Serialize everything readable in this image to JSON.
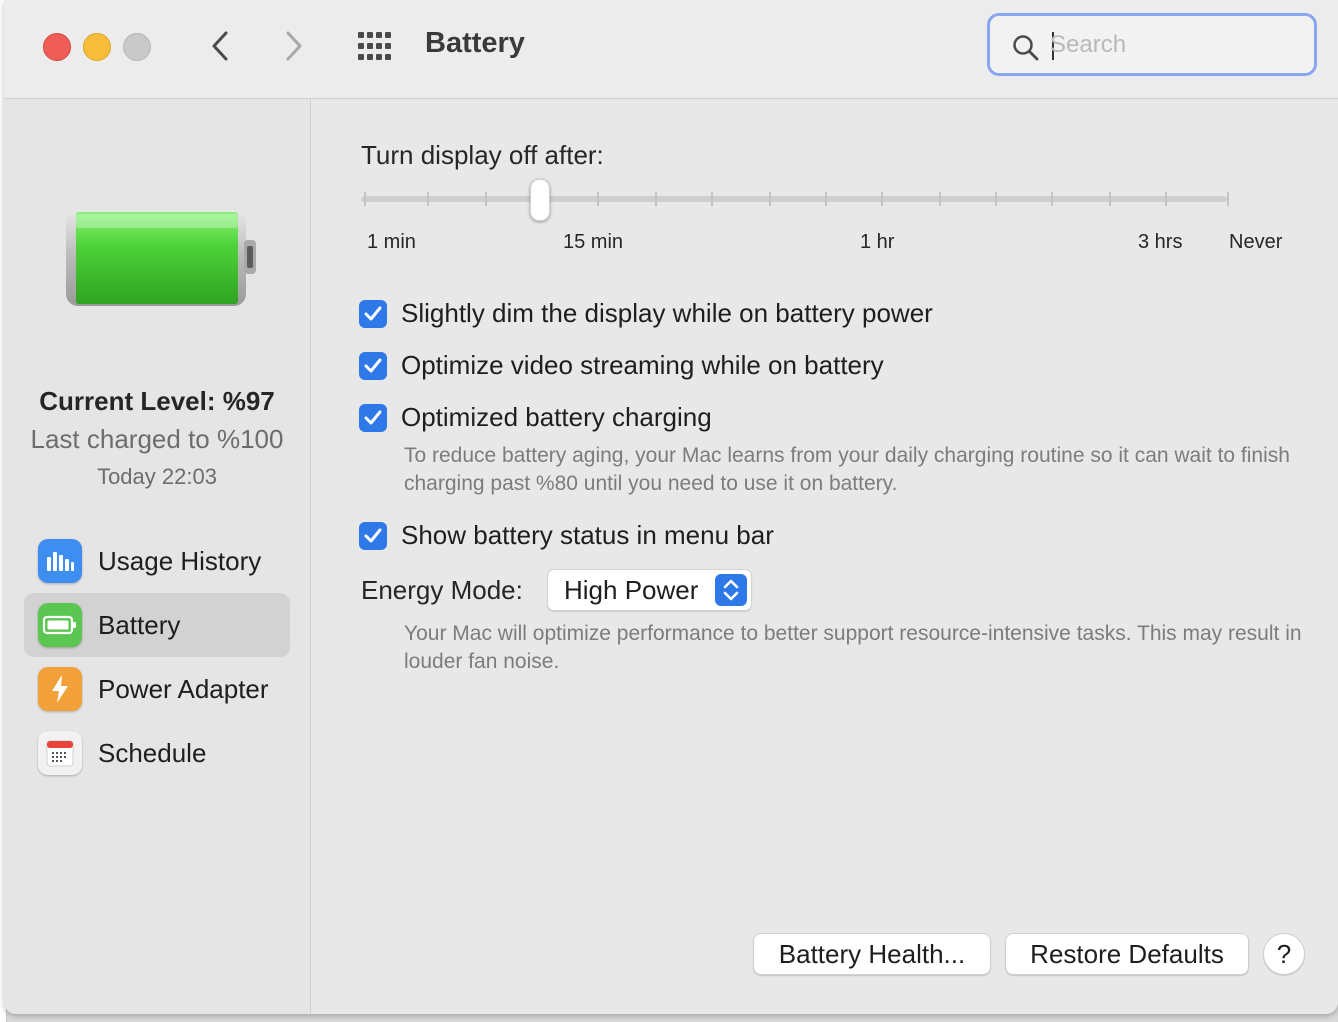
{
  "window": {
    "title": "Battery"
  },
  "search": {
    "placeholder": "Search",
    "value": ""
  },
  "sidebar": {
    "level_title": "Current Level: %97",
    "last_charged": "Last charged to %100",
    "charged_time": "Today 22:03",
    "items": [
      {
        "label": "Usage History",
        "icon": "bar-chart-icon",
        "color": "#3d8ef0",
        "selected": false
      },
      {
        "label": "Battery",
        "icon": "battery-icon",
        "color": "#5cc653",
        "selected": true
      },
      {
        "label": "Power Adapter",
        "icon": "lightning-icon",
        "color": "#f2a13a",
        "selected": false
      },
      {
        "label": "Schedule",
        "icon": "calendar-icon",
        "color": "#f2f2f2",
        "selected": false
      }
    ]
  },
  "display_slider": {
    "title": "Turn display off after:",
    "labels": [
      "1 min",
      "15 min",
      "1 hr",
      "3 hrs",
      "Never"
    ],
    "selected_value": "15 min"
  },
  "options": [
    {
      "label": "Slightly dim the display while on battery power",
      "checked": true
    },
    {
      "label": "Optimize video streaming while on battery",
      "checked": true
    },
    {
      "label": "Optimized battery charging",
      "checked": true
    },
    {
      "label": "Show battery status in menu bar",
      "checked": true
    }
  ],
  "charging_help": "To reduce battery aging, your Mac learns from your daily charging routine so it can wait to finish charging past %80 until you need to use it on battery.",
  "energy_mode": {
    "label": "Energy Mode:",
    "value": "High Power",
    "help": "Your Mac will optimize performance to better support resource-intensive tasks. This may result in louder fan noise."
  },
  "buttons": {
    "battery_health": "Battery Health...",
    "restore_defaults": "Restore Defaults",
    "help": "?"
  },
  "colors": {
    "accent": "#2f78e8",
    "battery_fill": "#4fd43a",
    "focus_ring": "#8aa6ee"
  }
}
